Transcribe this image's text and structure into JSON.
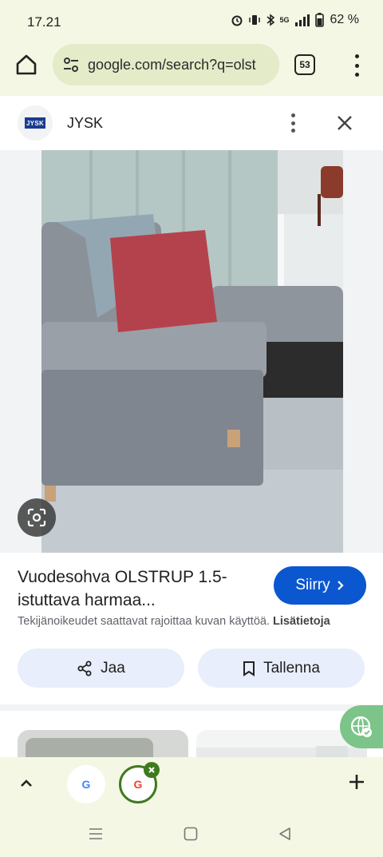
{
  "status_bar": {
    "time": "17.21",
    "network": "5G",
    "battery": "62 %"
  },
  "browser": {
    "url": "google.com/search?q=olst",
    "tab_count": "53"
  },
  "sheet": {
    "source_name": "JYSK",
    "logo_text": "JYSK",
    "title": "Vuodesohva OLSTRUP 1.5-istuttava harmaa...",
    "goto_label": "Siirry",
    "copyright_text": "Tekijänoikeudet saattavat rajoittaa kuvan käyttöä.",
    "more_info_label": "Lisätietoja",
    "share_label": "Jaa",
    "save_label": "Tallenna"
  },
  "colors": {
    "accent": "#0b57d0",
    "browser_bar": "#f4f7e3",
    "omnibox": "#e3ebc8",
    "tab_group": "#3f7a1f"
  },
  "icons": [
    "home-icon",
    "tune-icon",
    "more-vert-icon",
    "close-icon",
    "google-lens-icon",
    "share-icon",
    "bookmark-icon",
    "chevron-up-icon",
    "plus-icon",
    "recents-icon",
    "home-nav-icon",
    "back-icon"
  ]
}
